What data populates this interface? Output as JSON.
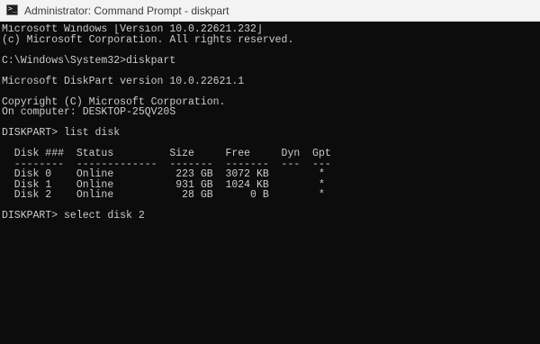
{
  "window": {
    "title": "Administrator: Command Prompt - diskpart",
    "icon": "cmd-icon",
    "icon_glyph": ">_"
  },
  "colors": {
    "console_background": "#0c0c0c",
    "console_text": "#cccccc",
    "titlebar_background": "#f3f3f3",
    "titlebar_text": "#3c3c3c"
  },
  "console": {
    "lines": [
      "Microsoft Windows [Version 10.0.22621.232]",
      "(c) Microsoft Corporation. All rights reserved.",
      "",
      "C:\\Windows\\System32>diskpart",
      "",
      "Microsoft DiskPart version 10.0.22621.1",
      "",
      "Copyright (C) Microsoft Corporation.",
      "On computer: DESKTOP-25QV20S",
      "",
      "DISKPART> list disk",
      "",
      "  Disk ###  Status         Size     Free     Dyn  Gpt",
      "  --------  -------------  -------  -------  ---  ---",
      "  Disk 0    Online          223 GB  3072 KB        *",
      "  Disk 1    Online          931 GB  1024 KB        *",
      "  Disk 2    Online           28 GB      0 B        *",
      "",
      "DISKPART> select disk 2"
    ]
  }
}
